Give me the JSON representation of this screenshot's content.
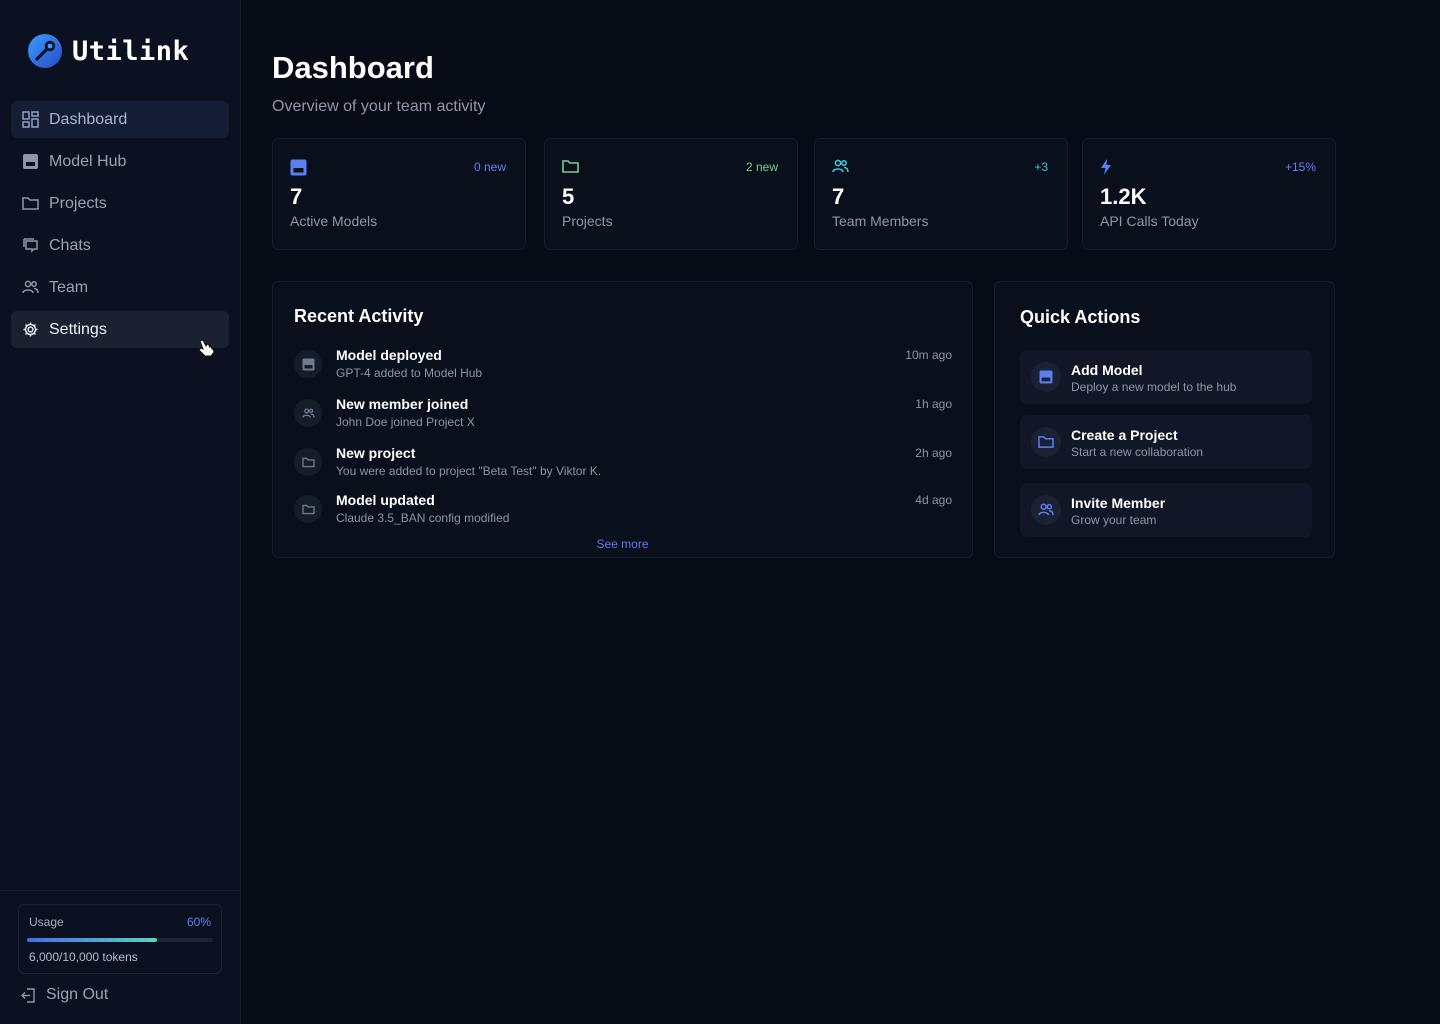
{
  "brand": {
    "name": "Utilink"
  },
  "sidebar": {
    "items": [
      {
        "label": "Dashboard",
        "icon": "dashboard-icon"
      },
      {
        "label": "Model Hub",
        "icon": "model-hub-icon"
      },
      {
        "label": "Projects",
        "icon": "folder-icon"
      },
      {
        "label": "Chats",
        "icon": "chat-icon"
      },
      {
        "label": "Team",
        "icon": "team-icon"
      },
      {
        "label": "Settings",
        "icon": "gear-icon"
      }
    ],
    "usage": {
      "label": "Usage",
      "percent_label": "60%",
      "percent": 60,
      "tokens": "6,000/10,000 tokens"
    },
    "sign_out": "Sign Out"
  },
  "header": {
    "title": "Dashboard",
    "subtitle": "Overview of your team activity"
  },
  "stats": [
    {
      "value": "7",
      "label": "Active Models",
      "badge": "0 new",
      "badge_color": "#5d7ff2",
      "icon": "model-icon",
      "icon_color": "#5b7ff0"
    },
    {
      "value": "5",
      "label": "Projects",
      "badge": "2 new",
      "badge_color": "#6fd28a",
      "icon": "folder-icon",
      "icon_color": "#6fd28a"
    },
    {
      "value": "7",
      "label": "Team Members",
      "badge": "+3",
      "badge_color": "#3ac6d6",
      "icon": "team-icon",
      "icon_color": "#3ac6d6"
    },
    {
      "value": "1.2K",
      "label": "API Calls Today",
      "badge": "+15%",
      "badge_color": "#5d7ff2",
      "icon": "lightning-icon",
      "icon_color": "#5b7ff0"
    }
  ],
  "recent_activity": {
    "title": "Recent Activity",
    "items": [
      {
        "title": "Model deployed",
        "desc": "GPT-4 added to Model Hub",
        "time": "10m  ago",
        "icon": "model-icon"
      },
      {
        "title": "New member joined",
        "desc": "John Doe joined Project X",
        "time": "1h  ago",
        "icon": "team-icon"
      },
      {
        "title": "New project",
        "desc": "You were added to project \"Beta Test\" by  Viktor K.",
        "time": "2h  ago",
        "icon": "folder-icon"
      },
      {
        "title": "Model updated",
        "desc": "Claude 3.5_BAN config modified",
        "time": "4d  ago",
        "icon": "folder-icon"
      }
    ],
    "see_more": "See more"
  },
  "quick_actions": {
    "title": "Quick Actions",
    "items": [
      {
        "title": "Add Model",
        "desc": "Deploy a new model to the hub",
        "icon": "model-icon"
      },
      {
        "title": "Create a Project",
        "desc": "Start a new collaboration",
        "icon": "folder-icon"
      },
      {
        "title": "Invite Member",
        "desc": "Grow your team",
        "icon": "team-icon"
      }
    ]
  }
}
